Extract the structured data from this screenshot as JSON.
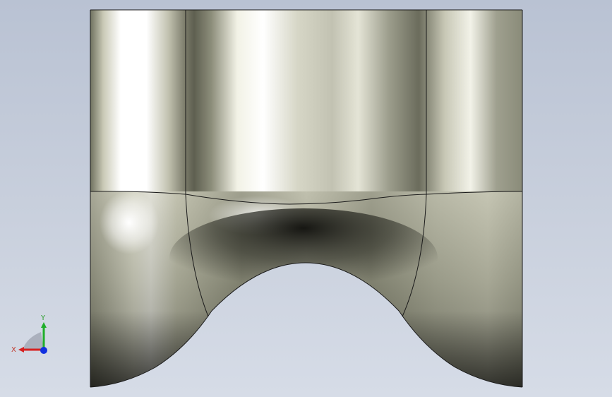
{
  "viewport": {
    "background_top": "#b9c2d3",
    "background_bottom": "#d6dce7",
    "model": {
      "surface_highlight": "#ffffff",
      "surface_mid": "#9a9a8a",
      "surface_dark": "#1b1b17",
      "edge_color": "#1a1a1a"
    }
  },
  "triad": {
    "x_label": "X",
    "y_label": "Y",
    "x_color": "#d62020",
    "y_color": "#1fae2a",
    "z_color": "#1030e0"
  }
}
